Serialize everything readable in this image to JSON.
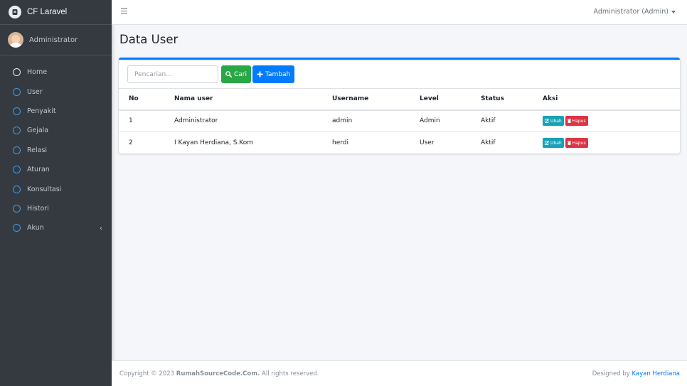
{
  "brand": {
    "name": "CF Laravel",
    "logo_icon": "brand-logo-icon"
  },
  "user_panel": {
    "name": "Administrator"
  },
  "sidebar": {
    "items": [
      {
        "label": "Home"
      },
      {
        "label": "User"
      },
      {
        "label": "Penyakit"
      },
      {
        "label": "Gejala"
      },
      {
        "label": "Relasi"
      },
      {
        "label": "Aturan"
      },
      {
        "label": "Konsultasi"
      },
      {
        "label": "Histori"
      },
      {
        "label": "Akun",
        "caret": "‹"
      }
    ]
  },
  "navbar": {
    "menu_icon": "hamburger-icon",
    "user_menu": "Administrator (Admin)"
  },
  "page": {
    "title": "Data User"
  },
  "toolbar": {
    "search_placeholder": "Pencarian...",
    "search_value": "",
    "cari_label": "Cari",
    "tambah_label": "Tambah"
  },
  "table": {
    "headers": [
      "No",
      "Nama user",
      "Username",
      "Level",
      "Status",
      "Aksi"
    ],
    "rows": [
      {
        "no": "1",
        "nama": "Administrator",
        "username": "admin",
        "level": "Admin",
        "status": "Aktif"
      },
      {
        "no": "2",
        "nama": "I Kayan Herdiana, S.Kom",
        "username": "herdi",
        "level": "User",
        "status": "Aktif"
      }
    ],
    "actions": {
      "edit": "Ubah",
      "delete": "Hapus"
    }
  },
  "footer": {
    "copyright_prefix": "Copyright © 2023 ",
    "copyright_site": "RumahSourceCode.Com.",
    "copyright_suffix": " All rights reserved.",
    "designed_prefix": "Designed by ",
    "designed_author": "Kayan Herdiana"
  },
  "colors": {
    "sidebar_bg": "#343a40",
    "accent": "#007bff",
    "success": "#28a745",
    "info": "#17a2b8",
    "danger": "#dc3545"
  }
}
